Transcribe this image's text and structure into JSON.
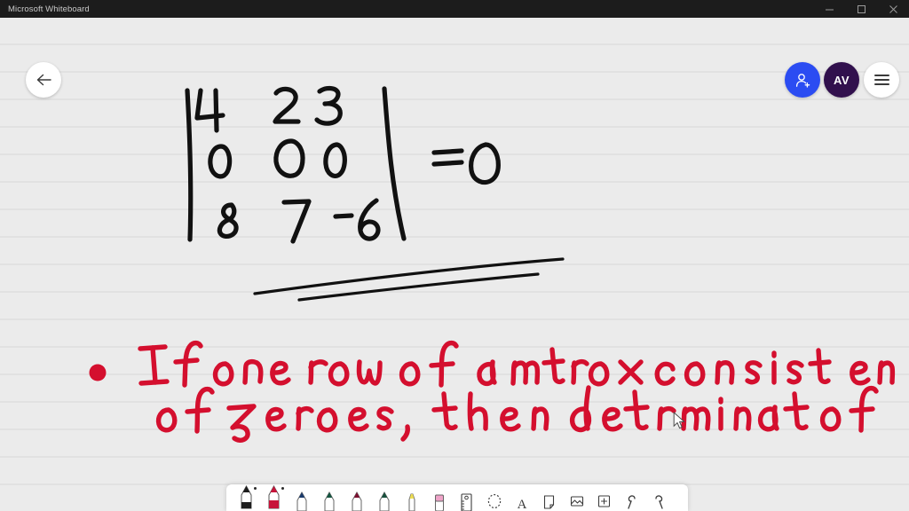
{
  "window": {
    "title": "Microsoft Whiteboard",
    "controls": [
      {
        "name": "minimize-button",
        "glyph": "minimize"
      },
      {
        "name": "maximize-button",
        "glyph": "maximize"
      },
      {
        "name": "close-button",
        "glyph": "close"
      }
    ]
  },
  "header": {
    "back_label": "Back",
    "share_label": "Share",
    "avatar_initials": "AV",
    "menu_label": "Settings and more"
  },
  "canvas": {
    "background_color": "#ebebeb",
    "rule_line_color": "#e1e1e1",
    "ink_black": "#111111",
    "ink_red": "#d40f2e",
    "matrix": {
      "rows": [
        [
          "4",
          "2",
          "3"
        ],
        [
          "0",
          "0",
          "0"
        ],
        [
          "8",
          "7",
          "-6"
        ]
      ],
      "equals": "= 0",
      "underline_strokes": 2
    },
    "note": {
      "bullet_color": "#d40f2e",
      "lines": [
        "If one row of a matrix  consist entirely",
        "of zeroes , then the determinant of"
      ]
    }
  },
  "toolbar": {
    "tools": [
      {
        "name": "pen-black",
        "icon": "pen-icon",
        "color": "#1d1d1d",
        "active": true,
        "dot": true
      },
      {
        "name": "pen-red",
        "icon": "pen-icon",
        "color": "#c7143a",
        "active": true,
        "dot": true
      },
      {
        "name": "pen-blue",
        "icon": "pen-icon",
        "color": "#1a3a6b",
        "active": false,
        "dot": false
      },
      {
        "name": "pen-green",
        "icon": "pen-icon",
        "color": "#14543f",
        "active": false,
        "dot": false
      },
      {
        "name": "pen-maroon",
        "icon": "pen-icon",
        "color": "#7c1030",
        "active": false,
        "dot": false
      },
      {
        "name": "pen-teal",
        "icon": "pen-icon",
        "color": "#17503c",
        "active": false,
        "dot": false
      },
      {
        "name": "highlighter",
        "icon": "highlighter-icon",
        "color": "#eede52",
        "active": false,
        "dot": false
      },
      {
        "name": "eraser",
        "icon": "eraser-icon",
        "color": "#efa3c8",
        "active": false,
        "dot": false
      },
      {
        "name": "ruler",
        "icon": "ruler-icon",
        "color": "#3c3c3c",
        "active": false,
        "dot": false
      },
      {
        "name": "lasso-select",
        "icon": "lasso-icon",
        "color": "#3c3c3c",
        "active": false,
        "dot": false
      },
      {
        "name": "text",
        "icon": "text-icon",
        "color": "#3c3c3c",
        "active": false,
        "dot": false
      },
      {
        "name": "sticky-note",
        "icon": "note-icon",
        "color": "#3c3c3c",
        "active": false,
        "dot": false
      },
      {
        "name": "insert-image",
        "icon": "image-icon",
        "color": "#3c3c3c",
        "active": false,
        "dot": false
      },
      {
        "name": "insert-more",
        "icon": "plus-box-icon",
        "color": "#3c3c3c",
        "active": false,
        "dot": false
      },
      {
        "name": "undo",
        "icon": "undo-icon",
        "color": "#3c3c3c",
        "active": false,
        "dot": false
      },
      {
        "name": "redo",
        "icon": "redo-icon",
        "color": "#3c3c3c",
        "active": false,
        "dot": false
      }
    ]
  }
}
